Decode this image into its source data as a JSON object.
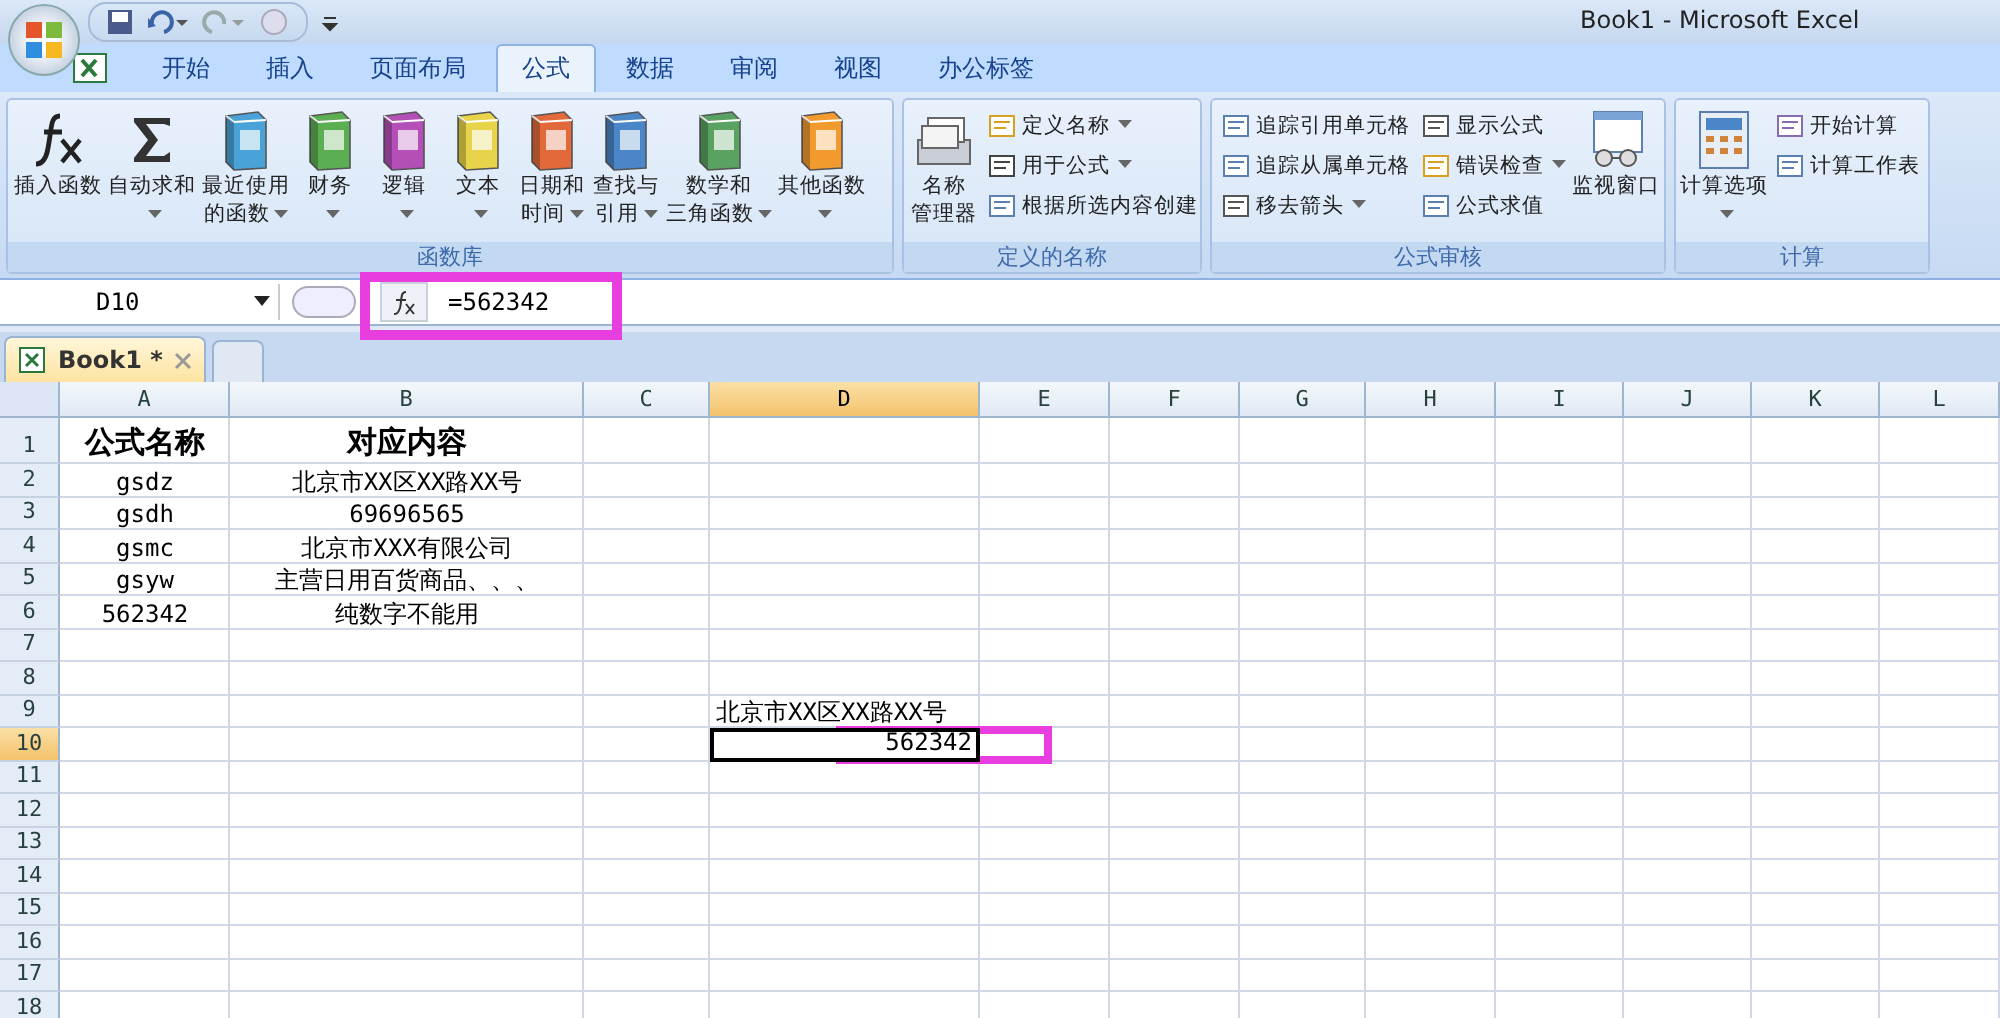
{
  "window": {
    "title": "Book1 - Microsoft Excel"
  },
  "tabs": [
    {
      "label": "开始",
      "selected": false
    },
    {
      "label": "插入",
      "selected": false
    },
    {
      "label": "页面布局",
      "selected": false
    },
    {
      "label": "公式",
      "selected": true
    },
    {
      "label": "数据",
      "selected": false
    },
    {
      "label": "审阅",
      "selected": false
    },
    {
      "label": "视图",
      "selected": false
    },
    {
      "label": "办公标签",
      "selected": false
    }
  ],
  "ribbon_groups": [
    {
      "label": "函数库",
      "items": [
        {
          "kind": "large",
          "lines": [
            "插入函数"
          ],
          "dropdown": false
        },
        {
          "kind": "large",
          "lines": [
            "自动求和"
          ],
          "dropdown": true
        },
        {
          "kind": "large",
          "lines": [
            "最近使用",
            "的函数"
          ],
          "dropdown": true
        },
        {
          "kind": "large",
          "lines": [
            "财务"
          ],
          "dropdown": true
        },
        {
          "kind": "large",
          "lines": [
            "逻辑"
          ],
          "dropdown": true
        },
        {
          "kind": "large",
          "lines": [
            "文本"
          ],
          "dropdown": true
        },
        {
          "kind": "large",
          "lines": [
            "日期和",
            "时间"
          ],
          "dropdown": true
        },
        {
          "kind": "large",
          "lines": [
            "查找与",
            "引用"
          ],
          "dropdown": true
        },
        {
          "kind": "large",
          "lines": [
            "数学和",
            "三角函数"
          ],
          "dropdown": true
        },
        {
          "kind": "large",
          "lines": [
            "其他函数"
          ],
          "dropdown": true
        }
      ]
    },
    {
      "label": "定义的名称",
      "items": [
        {
          "kind": "large",
          "lines": [
            "名称",
            "管理器"
          ],
          "dropdown": false
        },
        {
          "kind": "small",
          "label": "定义名称",
          "dropdown": true
        },
        {
          "kind": "small",
          "label": "用于公式",
          "dropdown": true
        },
        {
          "kind": "small",
          "label": "根据所选内容创建",
          "dropdown": false
        }
      ]
    },
    {
      "label": "公式审核",
      "items": [
        {
          "kind": "small",
          "label": "追踪引用单元格",
          "dropdown": false
        },
        {
          "kind": "small",
          "label": "追踪从属单元格",
          "dropdown": false
        },
        {
          "kind": "small",
          "label": "移去箭头",
          "dropdown": true
        },
        {
          "kind": "small",
          "label": "显示公式",
          "dropdown": false
        },
        {
          "kind": "small",
          "label": "错误检查",
          "dropdown": true
        },
        {
          "kind": "small",
          "label": "公式求值",
          "dropdown": false
        },
        {
          "kind": "large",
          "lines": [
            "监视窗口"
          ],
          "dropdown": false
        }
      ]
    },
    {
      "label": "计算",
      "items": [
        {
          "kind": "large",
          "lines": [
            "计算选项"
          ],
          "dropdown": true
        },
        {
          "kind": "small",
          "label": "开始计算",
          "dropdown": false
        },
        {
          "kind": "small",
          "label": "计算工作表",
          "dropdown": false
        }
      ]
    }
  ],
  "formula_bar": {
    "name_box": "D10",
    "formula": "=562342"
  },
  "workbook_tabs": [
    {
      "label": "Book1 *",
      "selected": true
    }
  ],
  "sheet": {
    "columns": [
      {
        "label": "A",
        "selected": false
      },
      {
        "label": "B",
        "selected": false
      },
      {
        "label": "C",
        "selected": false
      },
      {
        "label": "D",
        "selected": true
      },
      {
        "label": "E",
        "selected": false
      },
      {
        "label": "F",
        "selected": false
      },
      {
        "label": "G",
        "selected": false
      },
      {
        "label": "H",
        "selected": false
      },
      {
        "label": "I",
        "selected": false
      },
      {
        "label": "J",
        "selected": false
      },
      {
        "label": "K",
        "selected": false
      },
      {
        "label": "L",
        "selected": false
      }
    ],
    "rows": [
      {
        "header": "1",
        "selected": false,
        "bold": true,
        "cells": {
          "A": {
            "text": "公式名称",
            "kind": "centered"
          },
          "B": {
            "text": "对应内容",
            "kind": "centered"
          }
        }
      },
      {
        "header": "2",
        "selected": false,
        "cells": {
          "A": {
            "text": "gsdz",
            "kind": "centered"
          },
          "B": {
            "text": "北京市XX区XX路XX号",
            "kind": "centered"
          }
        }
      },
      {
        "header": "3",
        "selected": false,
        "cells": {
          "A": {
            "text": "gsdh",
            "kind": "centered"
          },
          "B": {
            "text": "69696565",
            "kind": "centered"
          }
        }
      },
      {
        "header": "4",
        "selected": false,
        "cells": {
          "A": {
            "text": "gsmc",
            "kind": "centered"
          },
          "B": {
            "text": "北京市XXX有限公司",
            "kind": "centered"
          }
        }
      },
      {
        "header": "5",
        "selected": false,
        "cells": {
          "A": {
            "text": "gsyw",
            "kind": "centered"
          },
          "B": {
            "text": "主营日用百货商品、、、",
            "kind": "centered"
          }
        }
      },
      {
        "header": "6",
        "selected": false,
        "cells": {
          "A": {
            "text": "562342",
            "kind": "centered"
          },
          "B": {
            "text": "纯数字不能用",
            "kind": "centered"
          }
        }
      },
      {
        "header": "7",
        "selected": false,
        "cells": {}
      },
      {
        "header": "8",
        "selected": false,
        "cells": {}
      },
      {
        "header": "9",
        "selected": false,
        "cells": {
          "D": {
            "text": "北京市XX区XX路XX号",
            "kind": "text"
          }
        }
      },
      {
        "header": "10",
        "selected": true,
        "cells": {
          "D": {
            "text": "562342",
            "kind": "number",
            "selected": true
          }
        }
      },
      {
        "header": "11",
        "selected": false,
        "cells": {}
      },
      {
        "header": "12",
        "selected": false,
        "cells": {}
      },
      {
        "header": "13",
        "selected": false,
        "cells": {}
      },
      {
        "header": "14",
        "selected": false,
        "cells": {}
      },
      {
        "header": "15",
        "selected": false,
        "cells": {}
      },
      {
        "header": "16",
        "selected": false,
        "cells": {}
      },
      {
        "header": "17",
        "selected": false,
        "cells": {}
      },
      {
        "header": "18",
        "selected": false,
        "cells": {}
      }
    ]
  }
}
